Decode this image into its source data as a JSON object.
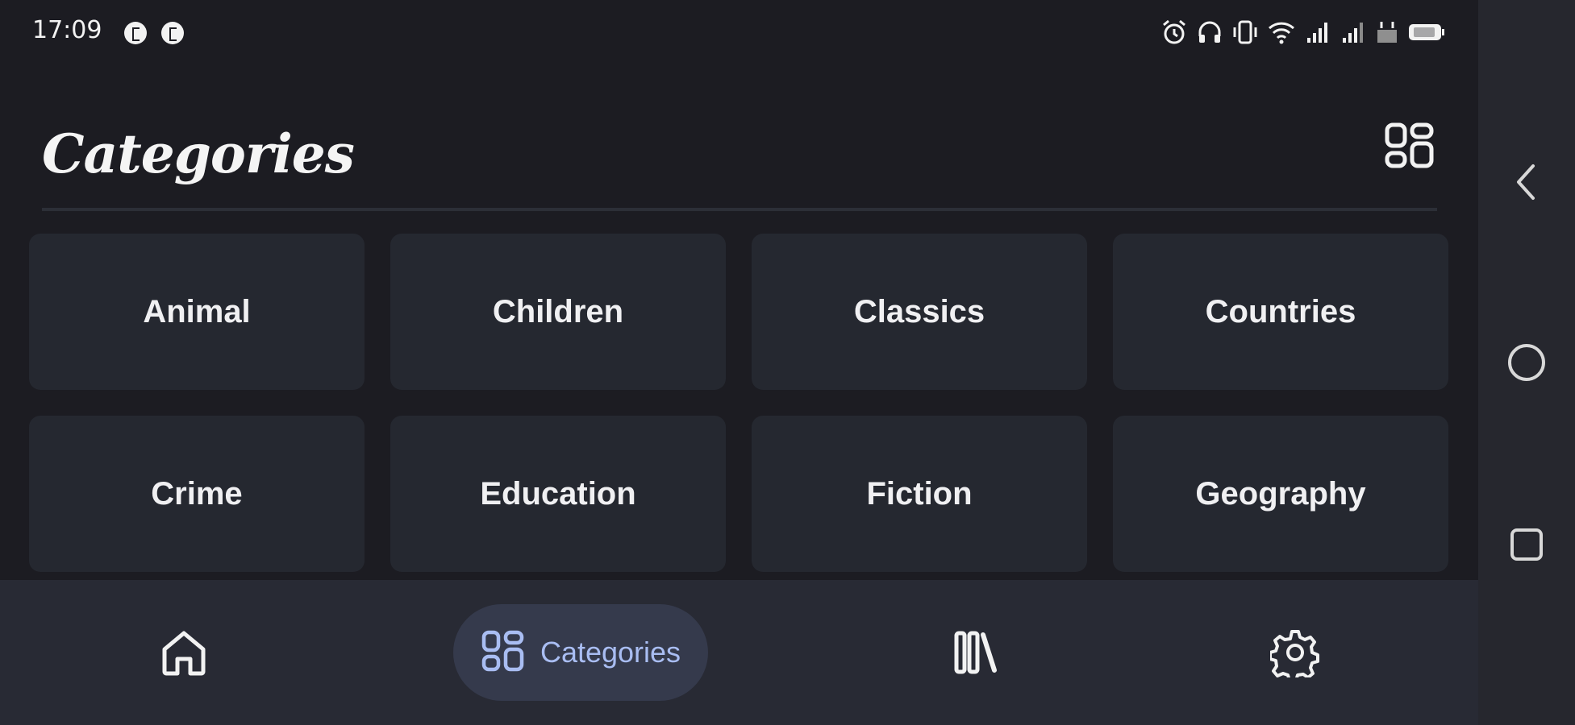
{
  "status_bar": {
    "time": "17:09",
    "notification_icons": [
      "notification-icon",
      "notification-icon"
    ],
    "right_icons": [
      "alarm-icon",
      "headphones-icon",
      "vibrate-icon",
      "wifi-icon",
      "signal-icon",
      "signal-icon",
      "data-icon",
      "battery-icon"
    ]
  },
  "header": {
    "title": "Categories",
    "layout_toggle_icon": "grid-layout-icon"
  },
  "categories": [
    {
      "label": "Animal"
    },
    {
      "label": "Children"
    },
    {
      "label": "Classics"
    },
    {
      "label": "Countries"
    },
    {
      "label": "Crime"
    },
    {
      "label": "Education"
    },
    {
      "label": "Fiction"
    },
    {
      "label": "Geography"
    }
  ],
  "bottom_nav": {
    "items": [
      {
        "icon": "home-icon",
        "active": false
      },
      {
        "icon": "categories-icon",
        "label": "Categories",
        "active": true
      },
      {
        "icon": "library-icon",
        "active": false
      },
      {
        "icon": "settings-icon",
        "active": false
      }
    ]
  },
  "system_nav": {
    "buttons": [
      "back-icon",
      "home-circle-icon",
      "recents-icon"
    ]
  },
  "colors": {
    "background": "#1c1c22",
    "card": "#252830",
    "nav_bar": "#282a34",
    "active_pill": "#353a4c",
    "active_label": "#a9bdf2"
  }
}
